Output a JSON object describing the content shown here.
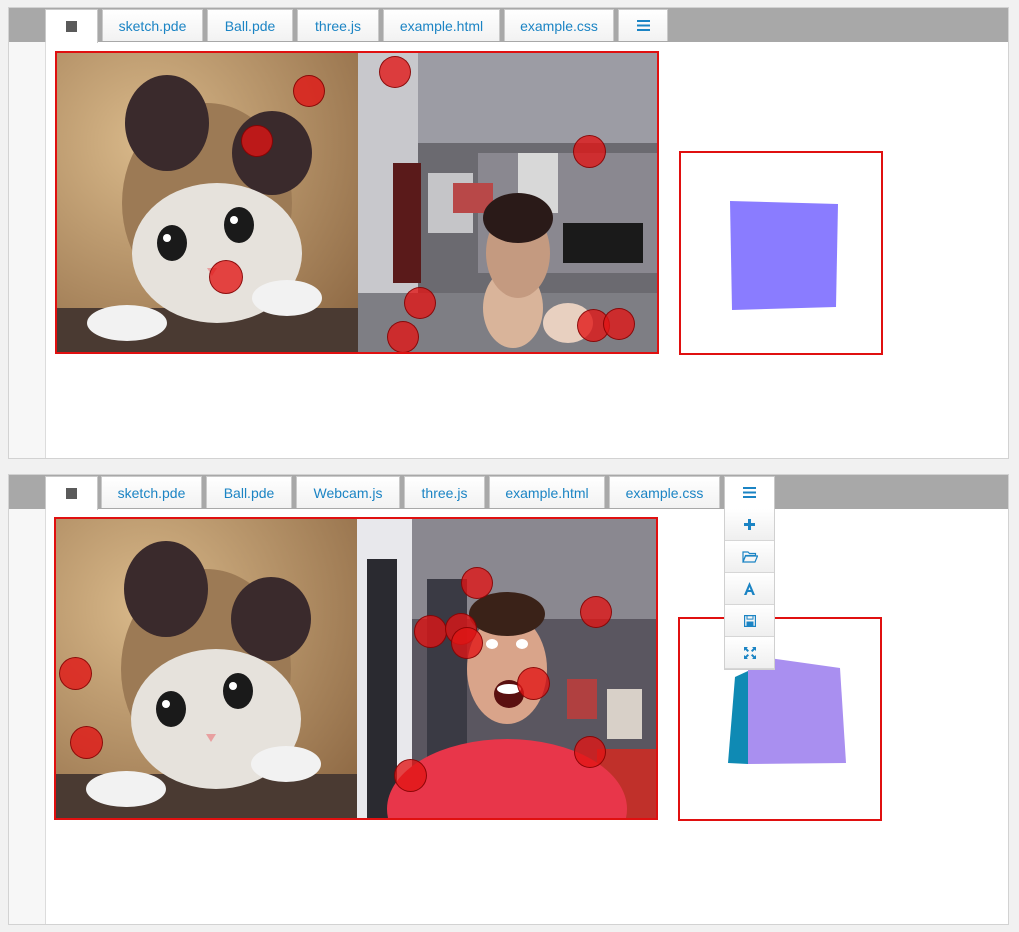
{
  "top_editor": {
    "tabs": [
      {
        "label": ""
      },
      {
        "label": "sketch.pde"
      },
      {
        "label": "Ball.pde"
      },
      {
        "label": "three.js"
      },
      {
        "label": "example.html"
      },
      {
        "label": "example.css"
      },
      {
        "label": ""
      }
    ]
  },
  "bottom_editor": {
    "tabs": [
      {
        "label": ""
      },
      {
        "label": "sketch.pde"
      },
      {
        "label": "Ball.pde"
      },
      {
        "label": "Webcam.js"
      },
      {
        "label": "three.js"
      },
      {
        "label": "example.html"
      },
      {
        "label": "example.css"
      },
      {
        "label": ""
      }
    ],
    "menu_items": [
      "plus-icon",
      "folder-open-icon",
      "font-icon",
      "save-icon",
      "fullscreen-icon"
    ]
  },
  "colors": {
    "accent_link": "#1b84c4",
    "frame_border": "#e01010",
    "ball_fill": "#e01414",
    "cube_front_top": "#8a7cff",
    "cube_front_bottom": "#a98ff0",
    "cube_side_bottom": "#0f8ab4"
  }
}
